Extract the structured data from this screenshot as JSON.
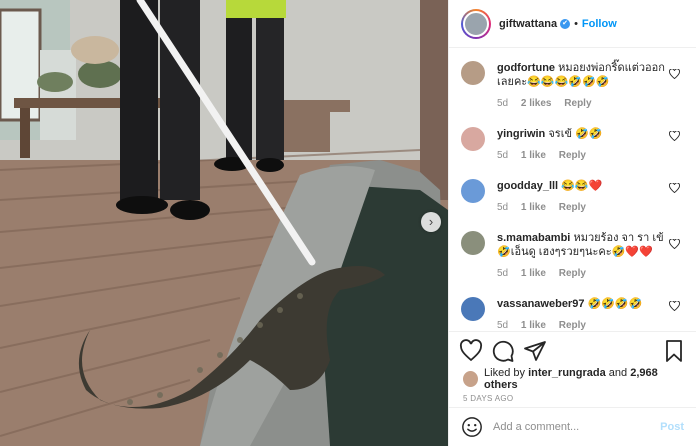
{
  "post": {
    "username": "giftwattana",
    "verified_mark": "✔",
    "separator": "•",
    "follow_label": "Follow",
    "next_arrow": "›"
  },
  "comments": [
    {
      "user": "godfortune",
      "text": "หมอยงพ่อกริ๊ดแต่วออกเลยคะ😂😂😂🤣🤣🤣",
      "time": "5d",
      "likes": "2 likes",
      "reply": "Reply",
      "avatar_color": "#b69c86"
    },
    {
      "user": "yingriwin",
      "text": "จรเข้ 🤣🤣",
      "time": "5d",
      "likes": "1 like",
      "reply": "Reply",
      "avatar_color": "#d8a8a0"
    },
    {
      "user": "goodday_lll",
      "text": "😂😂❤️",
      "time": "5d",
      "likes": "1 like",
      "reply": "Reply",
      "avatar_color": "#6a9ad8"
    },
    {
      "user": "s.mamabambi",
      "text": "หมวยร้อง จา รา เข้ 🤣เอ็นดู เฮงๆรวยๆนะคะ🤣❤️❤️",
      "time": "5d",
      "likes": "1 like",
      "reply": "Reply",
      "avatar_color": "#8a8f7c"
    },
    {
      "user": "vassanaweber97",
      "text": "🤣🤣🤣🤣",
      "time": "5d",
      "likes": "1 like",
      "reply": "Reply",
      "avatar_color": "#4a78b8"
    }
  ],
  "actions": {
    "liked_prefix": "Liked by",
    "liked_user": "inter_rungrada",
    "liked_and": "and",
    "liked_count": "2,968 others",
    "time_ago": "5 DAYS AGO"
  },
  "add_comment": {
    "placeholder": "Add a comment...",
    "post_label": "Post"
  },
  "icons": [
    "heart-icon",
    "comment-icon",
    "share-icon",
    "bookmark-icon",
    "emoji-icon",
    "chevron-right-icon",
    "verified-icon"
  ],
  "colors": {
    "link_blue": "#0095f6",
    "muted": "#8e8e8e",
    "border": "#efefef"
  }
}
